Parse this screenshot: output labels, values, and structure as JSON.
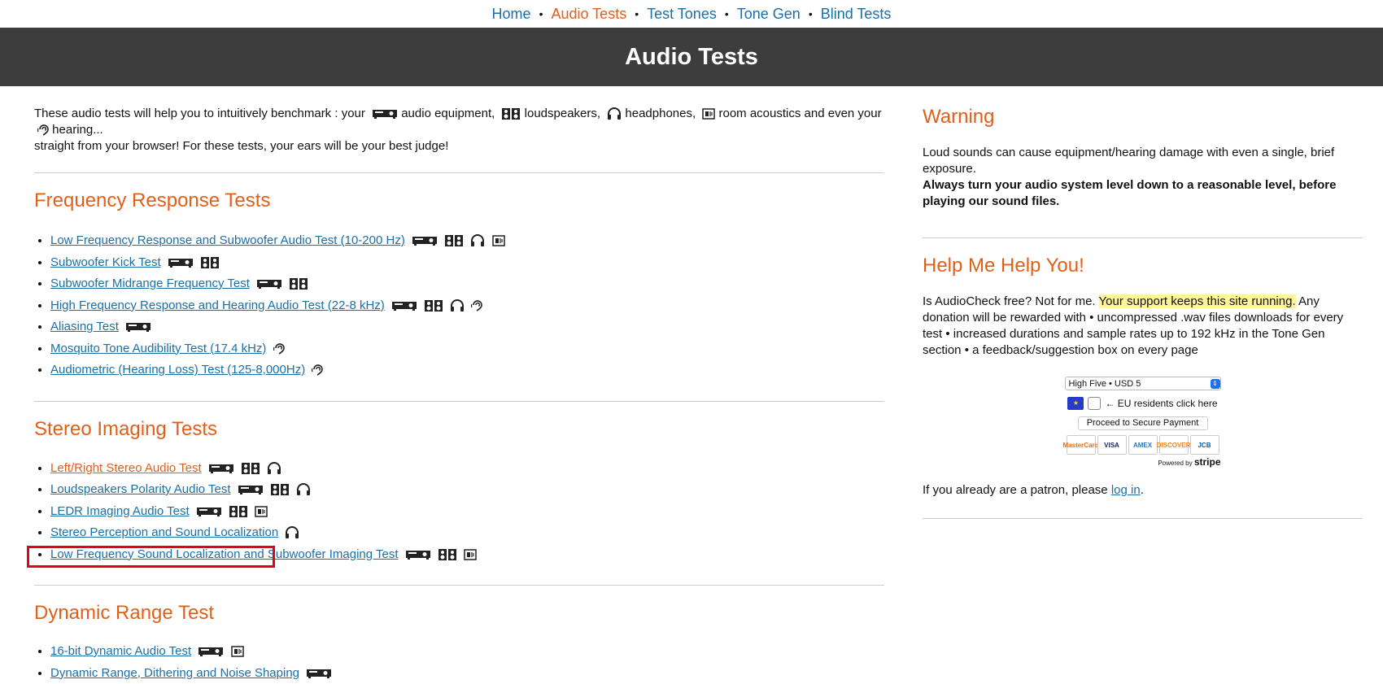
{
  "nav": {
    "items": [
      {
        "label": "Home",
        "active": false
      },
      {
        "label": "Audio Tests",
        "active": true
      },
      {
        "label": "Test Tones",
        "active": false
      },
      {
        "label": "Tone Gen",
        "active": false
      },
      {
        "label": "Blind Tests",
        "active": false
      }
    ],
    "separator": "•"
  },
  "banner": {
    "title": "Audio Tests"
  },
  "intro": {
    "p1": "These audio tests will help you to intuitively benchmark : your",
    "equipment": "audio equipment,",
    "speakers": "loudspeakers,",
    "headphones": "headphones,",
    "room": "room acoustics and even your",
    "hearing": "hearing...",
    "line2": "straight from your browser! For these tests, your ears will be your best judge!"
  },
  "sections": [
    {
      "title": "Frequency Response Tests",
      "items": [
        {
          "label": "Low Frequency Response and Subwoofer Audio Test (10-200 Hz)",
          "icons": [
            "amp-icon",
            "speakers-icon",
            "headphones-icon",
            "room-icon"
          ]
        },
        {
          "label": "Subwoofer Kick Test",
          "icons": [
            "amp-icon",
            "speakers-icon"
          ]
        },
        {
          "label": "Subwoofer Midrange Frequency Test",
          "icons": [
            "amp-icon",
            "speakers-icon"
          ]
        },
        {
          "label": "High Frequency Response and Hearing Audio Test (22-8 kHz)",
          "icons": [
            "amp-icon",
            "speakers-icon",
            "headphones-icon",
            "ear-icon"
          ]
        },
        {
          "label": "Aliasing Test",
          "icons": [
            "amp-icon"
          ]
        },
        {
          "label": "Mosquito Tone Audibility Test (17.4 kHz)",
          "icons": [
            "ear-icon"
          ]
        },
        {
          "label": "Audiometric (Hearing Loss) Test (125-8,000Hz)",
          "icons": [
            "ear-icon"
          ]
        }
      ]
    },
    {
      "title": "Stereo Imaging Tests",
      "items": [
        {
          "label": "Left/Right Stereo Audio Test",
          "icons": [
            "amp-icon",
            "speakers-icon",
            "headphones-icon"
          ],
          "highlight": true
        },
        {
          "label": "Loudspeakers Polarity Audio Test",
          "icons": [
            "amp-icon",
            "speakers-icon",
            "headphones-icon"
          ]
        },
        {
          "label": "LEDR Imaging Audio Test",
          "icons": [
            "amp-icon",
            "speakers-icon",
            "room-icon"
          ]
        },
        {
          "label": "Stereo Perception and Sound Localization",
          "icons": [
            "headphones-icon"
          ]
        },
        {
          "label": "Low Frequency Sound Localization and Subwoofer Imaging Test",
          "icons": [
            "amp-icon",
            "speakers-icon",
            "room-icon"
          ]
        }
      ]
    },
    {
      "title": "Dynamic Range Test",
      "items": [
        {
          "label": "16-bit Dynamic Audio Test",
          "icons": [
            "amp-icon",
            "room-icon"
          ]
        },
        {
          "label": "Dynamic Range, Dithering and Noise Shaping",
          "icons": [
            "amp-icon"
          ]
        }
      ]
    }
  ],
  "sidebar": {
    "warning_title": "Warning",
    "warning_text": "Loud sounds can cause equipment/hearing damage with even a single, brief exposure.",
    "warning_bold": "Always turn your audio system level down to a reasonable level, before playing our sound files.",
    "help_title": "Help Me Help You!",
    "help_pre": "Is AudioCheck free? Not for me.",
    "help_mark": "Your support keeps this site running.",
    "help_post": "Any donation will be rewarded with • uncompressed .wav files downloads for every test • increased durations and sample rates up to 192 kHz in the Tone Gen section • a feedback/suggestion box on every page",
    "donation_select": "High Five • USD 5",
    "eu_label": "← EU residents click here",
    "pay_button": "Proceed to Secure Payment",
    "cards": [
      "MasterCard",
      "VISA",
      "AMEX",
      "DISCOVER",
      "JCB"
    ],
    "powered_by": "Powered by",
    "stripe": "stripe",
    "patron_pre": "If you already are a patron, please",
    "patron_link": "log in",
    "patron_post": "."
  },
  "colors": {
    "accent": "#e0601a",
    "link": "#1b6fa8",
    "banner": "#3d3d3d",
    "highlight_box": "#e3001b"
  }
}
